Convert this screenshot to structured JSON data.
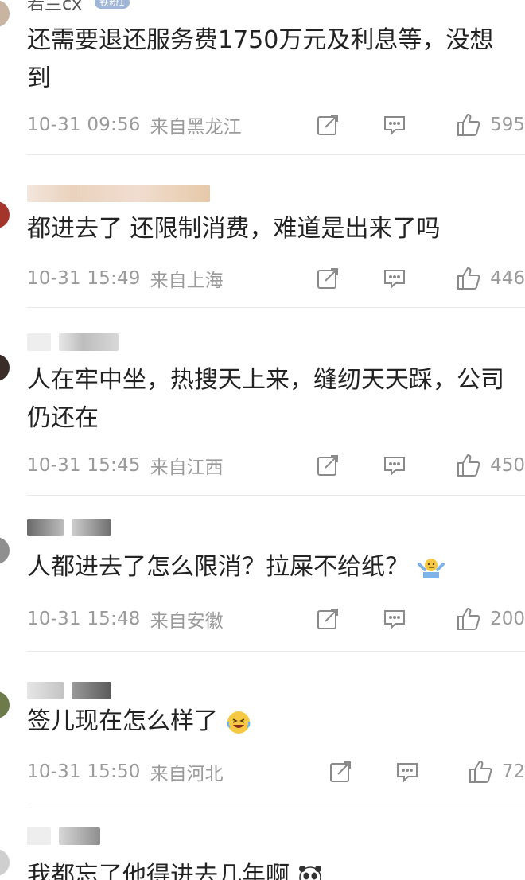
{
  "comments": [
    {
      "username": "若兰cx",
      "badge": "铁粉1",
      "text": "还需要退还服务费1750万元及利息等，没想到",
      "time": "10-31 09:56",
      "location": "来自黑龙江",
      "likes": "595"
    },
    {
      "text": "都进去了 还限制消费，难道是出来了吗",
      "time": "10-31 15:49",
      "location": "来自上海",
      "likes": "446"
    },
    {
      "text": "人在牢中坐，热搜天上来，缝纫天天踩，公司仍还在",
      "time": "10-31 15:45",
      "location": "来自江西",
      "likes": "450"
    },
    {
      "text": "人都进去了怎么限消？拉屎不给纸？",
      "time": "10-31 15:48",
      "location": "来自安徽",
      "likes": "200"
    },
    {
      "text": "签儿现在怎么样了",
      "time": "10-31 15:50",
      "location": "来自河北",
      "likes": "72"
    },
    {
      "text": "我都忘了他得进去几年啊"
    }
  ],
  "icons": {
    "repost": "repost-icon",
    "comment": "comment-icon",
    "like": "thumbs-up-icon",
    "emoji_shrug": "shrug-emoji-icon",
    "emoji_laugh": "laughing-emoji-icon",
    "emoji_panda": "panda-emoji-icon"
  },
  "colors": {
    "text": "#222222",
    "meta": "#9a9a9a",
    "divider": "#e8e8e8",
    "badge": "#9fb6d8"
  }
}
